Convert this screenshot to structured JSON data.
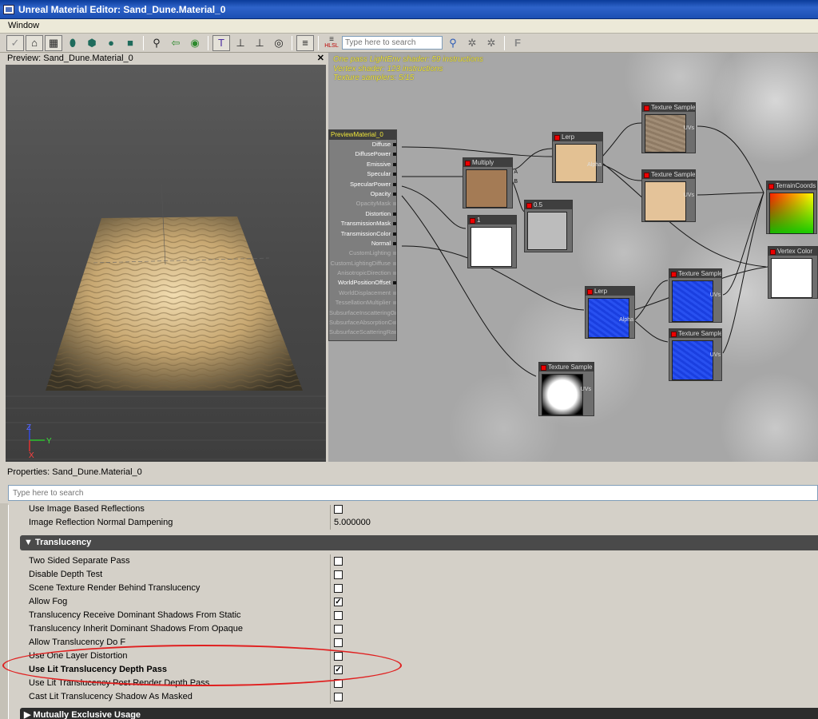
{
  "window": {
    "title": "Unreal Material Editor: Sand_Dune.Material_0"
  },
  "menu": {
    "window": "Window"
  },
  "toolbar": {
    "search_placeholder": "Type here to search",
    "hlsl_label": "HLSL",
    "font_icon_label": "F",
    "icons": [
      "check-icon",
      "home-icon",
      "grid-icon",
      "cylinder-icon",
      "cube-icon",
      "sphere-icon",
      "plane-icon",
      "magnifier-icon",
      "arrow-left-icon",
      "flag-icon",
      "realtime-icon",
      "pin-down-icon",
      "pin-up-icon",
      "eye-icon",
      "list-icon",
      "hlsl-icon",
      "search-go-icon",
      "expand-icon",
      "collapse-icon",
      "font-icon"
    ]
  },
  "preview": {
    "title": "Preview: Sand_Dune.Material_0",
    "close": "✕",
    "axis_z": "Z",
    "axis_y": "Y",
    "axis_x": "X"
  },
  "graph": {
    "stats": [
      "One pass LightEnv shader: 59 instructions",
      "Vertex shader: 123 instructions",
      "Texture samplers: 5/15"
    ],
    "material_node": {
      "title": "PreviewMaterial_0",
      "inputs": [
        {
          "label": "Diffuse",
          "active": true
        },
        {
          "label": "DiffusePower",
          "active": true
        },
        {
          "label": "Emissive",
          "active": true
        },
        {
          "label": "Specular",
          "active": true
        },
        {
          "label": "SpecularPower",
          "active": true
        },
        {
          "label": "Opacity",
          "active": true
        },
        {
          "label": "OpacityMask",
          "active": false
        },
        {
          "label": "Distortion",
          "active": true
        },
        {
          "label": "TransmissionMask",
          "active": true
        },
        {
          "label": "TransmissionColor",
          "active": true
        },
        {
          "label": "Normal",
          "active": true
        },
        {
          "label": "CustomLighting",
          "active": false
        },
        {
          "label": "CustomLightingDiffuse",
          "active": false
        },
        {
          "label": "AnisotropicDirection",
          "active": false
        },
        {
          "label": "WorldPositionOffset",
          "active": true
        },
        {
          "label": "WorldDisplacement",
          "active": false
        },
        {
          "label": "TessellationMultiplier",
          "active": false
        },
        {
          "label": "SubsurfaceInscatteringColor",
          "active": false
        },
        {
          "label": "SubsurfaceAbsorptionColor",
          "active": false
        },
        {
          "label": "SubsurfaceScatteringRadius",
          "active": false
        }
      ]
    },
    "nodes": {
      "lerp1": "Lerp",
      "multiply": "Multiply",
      "const05": "0.5",
      "const1": "1",
      "tex1": "Texture Sample",
      "tex2": "Texture Sample",
      "terrain": "TerrainCoords",
      "vertex_color": "Vertex Color",
      "lerp2": "Lerp",
      "tex3": "Texture Sample",
      "tex4": "Texture Sample",
      "tex5": "Texture Sample",
      "uvs": "UVs",
      "alpha": "Alpha",
      "a": "A",
      "b": "B"
    }
  },
  "properties": {
    "title": "Properties: Sand_Dune.Material_0",
    "search_placeholder": "Type here to search",
    "pre_rows": [
      {
        "name": "Use Image Based Reflections",
        "type": "checkbox",
        "checked": false
      },
      {
        "name": "Image Reflection Normal Dampening",
        "type": "value",
        "value": "5.000000"
      }
    ],
    "category": "Translucency",
    "rows": [
      {
        "name": "Two Sided Separate Pass",
        "checked": false
      },
      {
        "name": "Disable Depth Test",
        "checked": false
      },
      {
        "name": "Scene Texture Render Behind Translucency",
        "checked": false
      },
      {
        "name": "Allow Fog",
        "checked": true
      },
      {
        "name": "Translucency Receive Dominant Shadows From Static",
        "checked": false
      },
      {
        "name": "Translucency Inherit Dominant Shadows From Opaque",
        "checked": false
      },
      {
        "name": "Allow Translucency Do F",
        "checked": false
      },
      {
        "name": "Use One Layer Distortion",
        "checked": false
      },
      {
        "name": "Use Lit Translucency Depth Pass",
        "checked": true,
        "bold": true
      },
      {
        "name": "Use Lit Translucency Post Render Depth Pass",
        "checked": false
      },
      {
        "name": "Cast Lit Translucency Shadow As Masked",
        "checked": false
      }
    ],
    "next_category": "Mutually Exclusive Usage",
    "check_mark": "✓"
  },
  "colors": {
    "highlight_oval": "#e02020",
    "stats_text": "#f0e63a",
    "title_bar": "#0a3b99"
  }
}
